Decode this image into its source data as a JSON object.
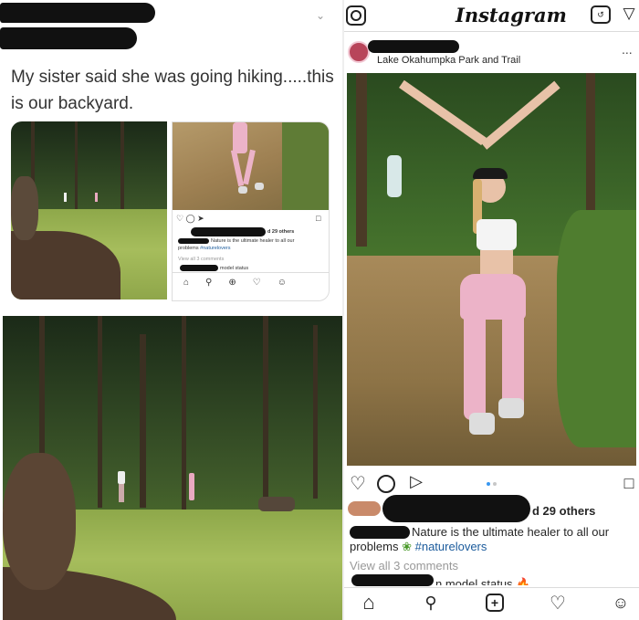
{
  "tweet": {
    "text": "My sister said she was going hiking.....this is our backyard.",
    "chevron_icon": "chevron-down-icon"
  },
  "mini_post": {
    "likes": "d 29 others",
    "caption_a": "Nature is the ultimate healer to all our",
    "caption_b": "problems",
    "hashtag": "#naturelovers",
    "comments": "View all 3 comments",
    "last_comment": "model status"
  },
  "instagram": {
    "logo": "Instagram",
    "location": "Lake Okahumpka Park and Trail",
    "more": "...",
    "likes": "d 29 others",
    "caption": "Nature is the ultimate healer to all our problems",
    "hashtag": "#naturelovers",
    "comments": "View all 3 comments",
    "last_comment": "n model status",
    "icons": [
      "camera-icon",
      "tv-icon",
      "send-icon",
      "heart-icon",
      "comment-icon",
      "share-icon",
      "bookmark-icon",
      "home-icon",
      "search-icon",
      "add-icon",
      "activity-icon",
      "profile-icon"
    ]
  },
  "colors": {
    "hashtag": "#1b5b9c",
    "pants": "#e9a9c0",
    "redaction": "#111111"
  }
}
